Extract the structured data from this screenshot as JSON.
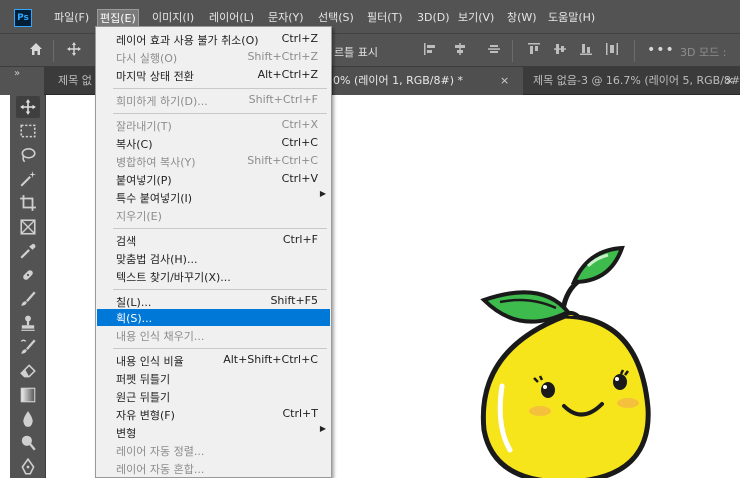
{
  "app": {
    "logo": "Ps"
  },
  "menubar": {
    "items": [
      "파일(F)",
      "편집(E)",
      "이미지(I)",
      "레이어(L)",
      "문자(Y)",
      "선택(S)",
      "필터(T)",
      "3D(D)",
      "보기(V)",
      "창(W)",
      "도움말(H)"
    ],
    "active_index": 1
  },
  "options": {
    "home_icon": "home-icon",
    "move_icon": "move-icon",
    "partial_label": "르틀 표시",
    "more": "•••",
    "mode_label": "3D 모드 :"
  },
  "panel": {
    "collapse_label": "»"
  },
  "tabs": [
    {
      "label": "제목 없",
      "active": false
    },
    {
      "label": "0% (레이어 1, RGB/8#) *",
      "active": true,
      "close": "×"
    },
    {
      "label": "제목 없음-3 @ 16.7% (레이어 5, RGB/8#) *",
      "active": false,
      "close": "×"
    }
  ],
  "edit_menu": {
    "items": [
      {
        "label": "레이어 효과 사용 불가 취소(O)",
        "shortcut": "Ctrl+Z",
        "state": "enabled"
      },
      {
        "label": "다시 실행(O)",
        "shortcut": "Shift+Ctrl+Z",
        "state": "disabled"
      },
      {
        "label": "마지막 상태 전환",
        "shortcut": "Alt+Ctrl+Z",
        "state": "enabled"
      },
      {
        "label": "희미하게 하기(D)...",
        "shortcut": "Shift+Ctrl+F",
        "state": "disabled"
      },
      {
        "label": "잘라내기(T)",
        "shortcut": "Ctrl+X",
        "state": "disabled"
      },
      {
        "label": "복사(C)",
        "shortcut": "Ctrl+C",
        "state": "enabled"
      },
      {
        "label": "병합하여 복사(Y)",
        "shortcut": "Shift+Ctrl+C",
        "state": "disabled"
      },
      {
        "label": "붙여넣기(P)",
        "shortcut": "Ctrl+V",
        "state": "enabled"
      },
      {
        "label": "특수 붙여넣기(I)",
        "shortcut": "",
        "state": "enabled",
        "submenu": true
      },
      {
        "label": "지우기(E)",
        "shortcut": "",
        "state": "disabled"
      },
      {
        "label": "검색",
        "shortcut": "Ctrl+F",
        "state": "enabled"
      },
      {
        "label": "맞춤법 검사(H)...",
        "shortcut": "",
        "state": "enabled"
      },
      {
        "label": "텍스트 찾기/바꾸기(X)...",
        "shortcut": "",
        "state": "enabled"
      },
      {
        "label": "칠(L)...",
        "shortcut": "Shift+F5",
        "state": "enabled"
      },
      {
        "label": "획(S)...",
        "shortcut": "",
        "state": "highlighted"
      },
      {
        "label": "내용 인식 채우기...",
        "shortcut": "",
        "state": "disabled"
      },
      {
        "label": "내용 인식 비율",
        "shortcut": "Alt+Shift+Ctrl+C",
        "state": "enabled"
      },
      {
        "label": "퍼펫 뒤틀기",
        "shortcut": "",
        "state": "enabled"
      },
      {
        "label": "원근 뒤틀기",
        "shortcut": "",
        "state": "enabled"
      },
      {
        "label": "자유 변형(F)",
        "shortcut": "Ctrl+T",
        "state": "enabled"
      },
      {
        "label": "변형",
        "shortcut": "",
        "state": "enabled",
        "submenu": true
      },
      {
        "label": "레이어 자동 정렬...",
        "shortcut": "",
        "state": "disabled"
      },
      {
        "label": "레이어 자동 혼합...",
        "shortcut": "",
        "state": "disabled"
      }
    ],
    "submenu_arrow": "▶"
  },
  "toolbar": {
    "tools": [
      "move-tool",
      "marquee-tool",
      "lasso-tool",
      "magic-wand-tool",
      "crop-tool",
      "frame-tool",
      "eyedropper-tool",
      "healing-brush-tool",
      "brush-tool",
      "clone-stamp-tool",
      "history-brush-tool",
      "eraser-tool",
      "gradient-tool",
      "blur-tool",
      "dodge-tool",
      "pen-tool"
    ],
    "active": "move-tool"
  },
  "colors": {
    "chrome": "#535353",
    "menu_bg": "#f0f0f0",
    "highlight": "#0078d7",
    "lemon": "#f7e51c",
    "leaf": "#2fb34a"
  }
}
